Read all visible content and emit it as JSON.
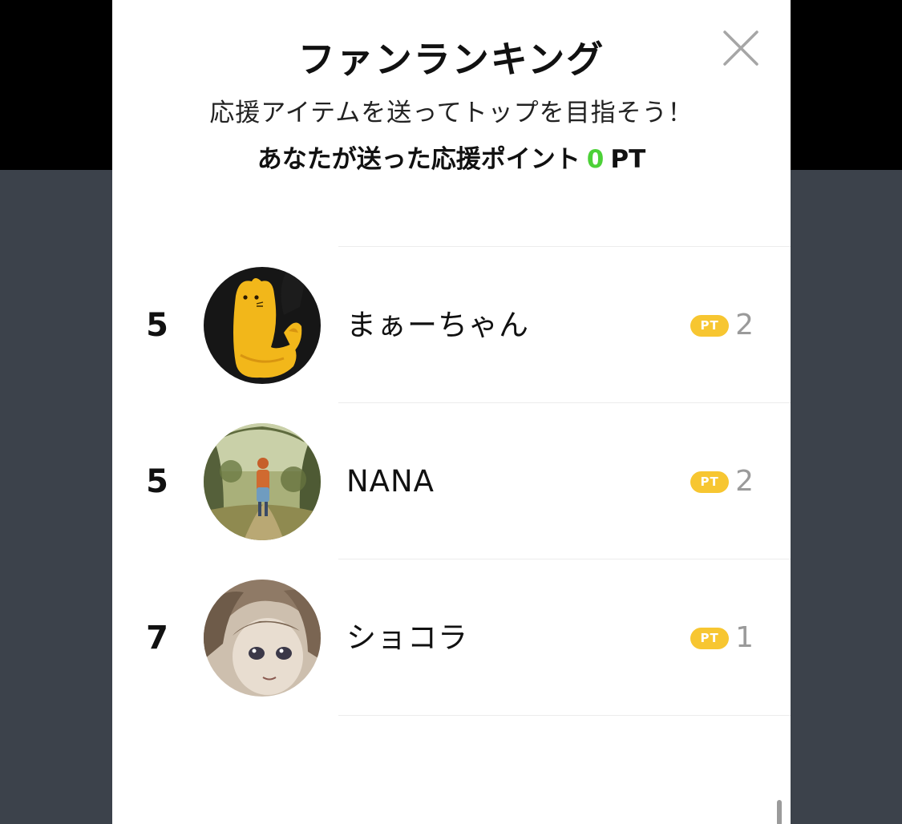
{
  "modal": {
    "title": "ファンランキング",
    "subtitle": "応援アイテムを送ってトップを目指そう！",
    "points_label": "あなたが送った応援ポイント",
    "points_value": "0",
    "points_unit": "PT",
    "close_icon": "close-icon"
  },
  "ranking": [
    {
      "rank": "5",
      "name": "まぁーちゃん",
      "badge": "PT",
      "score": "2",
      "avatar": "yellow-cat-plush-avatar"
    },
    {
      "rank": "5",
      "name": "NANA",
      "badge": "PT",
      "score": "2",
      "avatar": "forest-path-girl-avatar"
    },
    {
      "rank": "7",
      "name": "ショコラ",
      "badge": "PT",
      "score": "1",
      "avatar": "anime-girl-sketch-avatar"
    }
  ],
  "colors": {
    "accent_green": "#4cd137",
    "badge_yellow": "#f7c631",
    "backdrop_top": "#000000",
    "backdrop": "#3c424b"
  }
}
